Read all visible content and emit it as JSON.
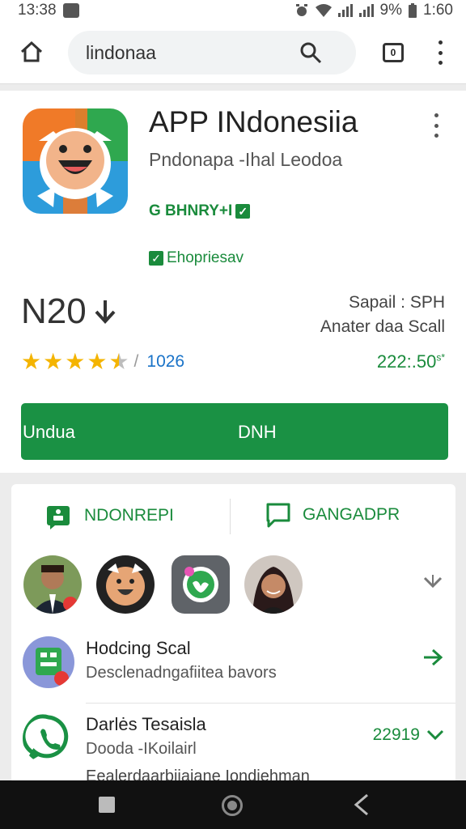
{
  "status_bar": {
    "time_left": "13:38",
    "battery": "9%",
    "time_right": "1:60"
  },
  "browser": {
    "url_text": "lindonaa",
    "tab_count": "0"
  },
  "app": {
    "title": "APP INdonesiia",
    "developer": "Pndonapa -Ihal Leodoa",
    "badge_1": "G BHNRY+I",
    "badge_2": "Ehopriesav",
    "rating_value": "N20",
    "rating_stars": 4.5,
    "review_separator": "/",
    "review_count": "1026",
    "info_line_1": "Sapail : SPH",
    "info_line_2": "Anater daa Scall",
    "size_value": "222:.50",
    "size_suffix": "s*",
    "install_left_label": "Undua",
    "install_center_label": "DNH"
  },
  "tabs": [
    {
      "label": "NDONREPI"
    },
    {
      "label": "GANGADPR"
    }
  ],
  "list": [
    {
      "title": "Hodcing Scal",
      "subtitle": "Desclenadngafiitea bavors"
    },
    {
      "title": "Darlės Tesaisla",
      "subtitle": "Dooda -IKoilairl",
      "meta": "22919"
    }
  ],
  "peek_text": "Eealerdaarbiiaiane  Iondiehman",
  "colors": {
    "accent_green": "#1a9144",
    "star_yellow": "#f4b400",
    "link_blue": "#1a73c8"
  }
}
